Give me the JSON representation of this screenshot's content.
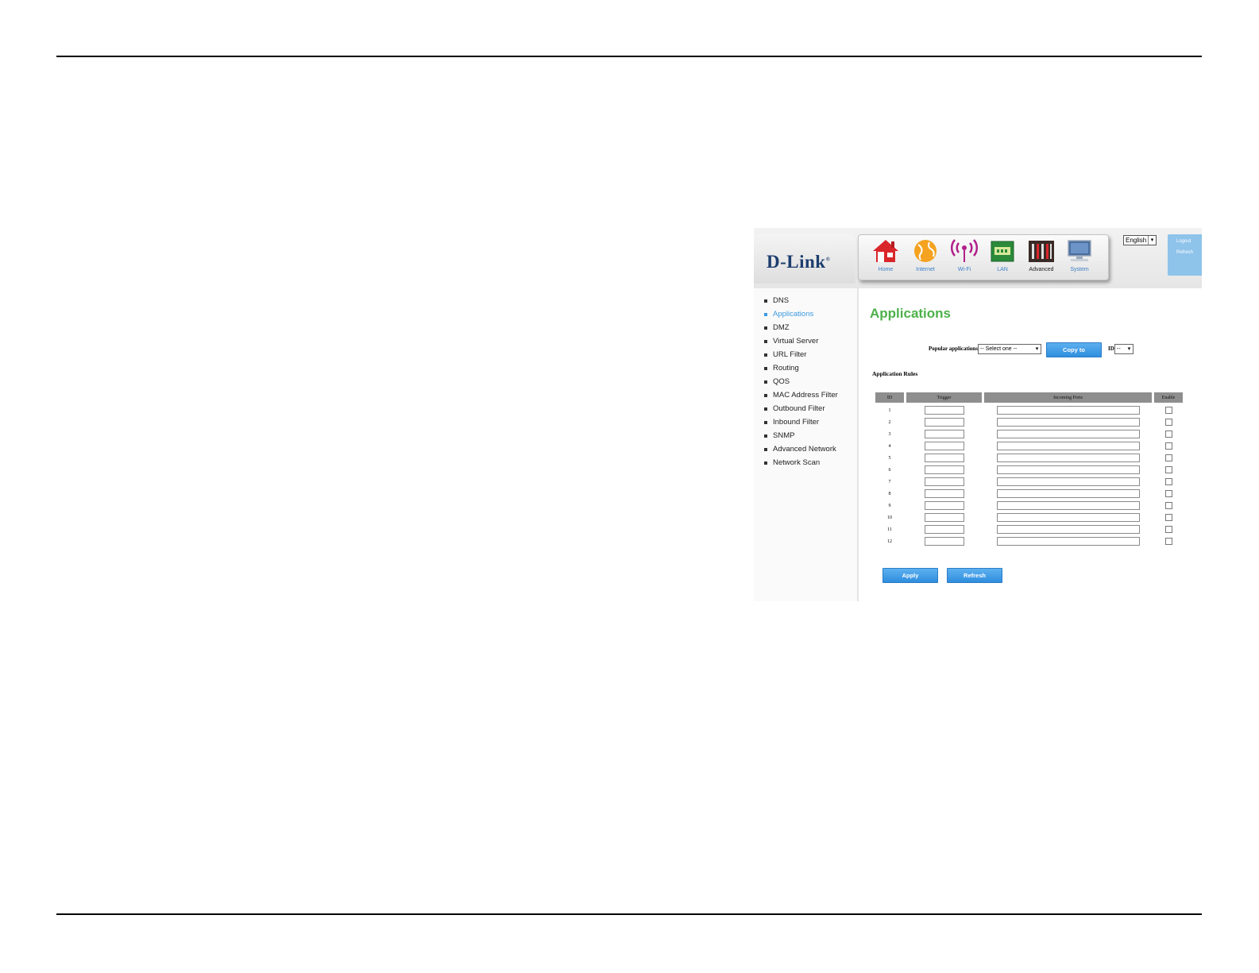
{
  "brand": {
    "logo": "D-Link",
    "mark": "®"
  },
  "nav": [
    {
      "label": "Home",
      "icon": "home-icon"
    },
    {
      "label": "Internet",
      "icon": "globe-icon"
    },
    {
      "label": "Wi-Fi",
      "icon": "wifi-icon"
    },
    {
      "label": "LAN",
      "icon": "lan-icon"
    },
    {
      "label": "Advanced",
      "icon": "advanced-tools-icon",
      "active": true
    },
    {
      "label": "System",
      "icon": "monitor-icon"
    }
  ],
  "language": {
    "selected": "English"
  },
  "side_panel": {
    "logout": "Logout",
    "refresh": "Refresh"
  },
  "menu": [
    "DNS",
    "Applications",
    "DMZ",
    "Virtual Server",
    "URL Filter",
    "Routing",
    "QOS",
    "MAC Address Filter",
    "Outbound Filter",
    "Inbound Filter",
    "SNMP",
    "Advanced Network",
    "Network Scan"
  ],
  "menu_active": "Applications",
  "page": {
    "title": "Applications",
    "popular_label": "Popular applications",
    "popular_selected": "-- Select one --",
    "copy_button": "Copy to",
    "id_label": "ID",
    "id_selected": "--",
    "rules_title": "Application Rules",
    "columns": [
      "ID",
      "Trigger",
      "Incoming Ports",
      "Enable"
    ],
    "rows": [
      "1",
      "2",
      "3",
      "4",
      "5",
      "6",
      "7",
      "8",
      "9",
      "10",
      "11",
      "12"
    ],
    "apply_button": "Apply",
    "refresh_button": "Refresh"
  },
  "colors": {
    "accent_green": "#4db14a",
    "link_blue": "#3b9ae1",
    "button_blue": "#2f8ede"
  }
}
